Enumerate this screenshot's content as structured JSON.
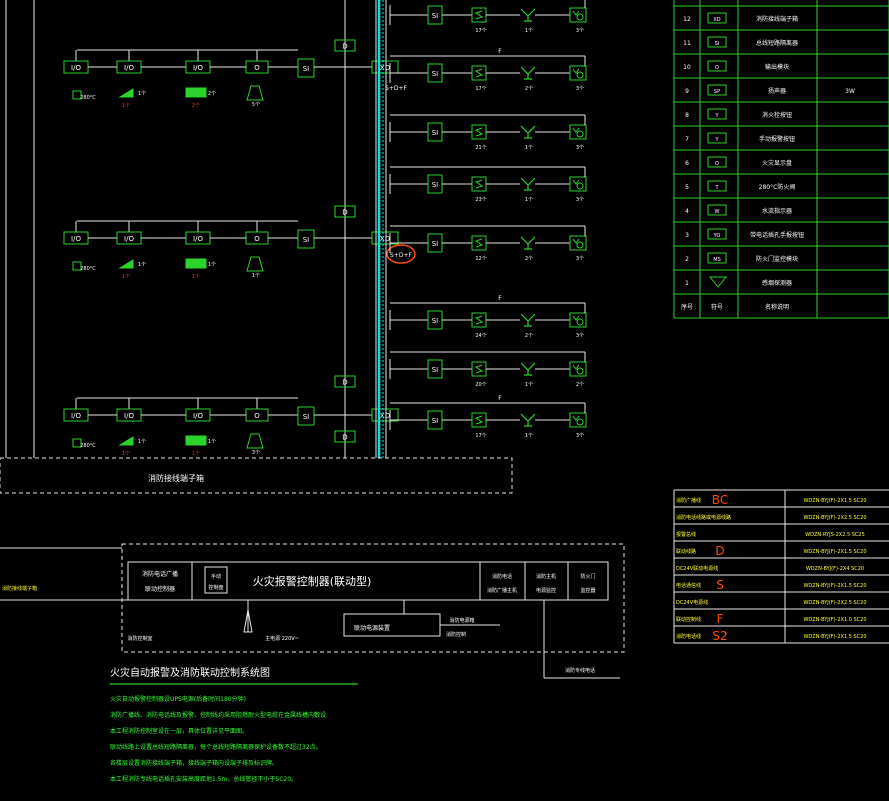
{
  "colors": {
    "background": "#000000",
    "line": "#e6e6e6",
    "device": "#2ad42a",
    "text": "#ffffff",
    "green_text": "#33ff33",
    "red_text": "#ff3030",
    "cyan": "#00e6e6",
    "annotation": "#ff4b00",
    "yellow": "#ffff33"
  },
  "floor_modules": {
    "rows": [
      {
        "io1": "I/O",
        "io2": "I/O",
        "io3": "I/O",
        "o": "O",
        "si": "SI",
        "xd": "XD",
        "temp_label": "280°C",
        "count_1": "1个",
        "count_2": "2个",
        "count_3": "5个"
      },
      {
        "io1": "I/O",
        "io2": "I/O",
        "io3": "I/O",
        "o": "O",
        "si": "SI",
        "xd": "XD",
        "temp_label": "280°C",
        "count_1": "1个",
        "count_2": "1个",
        "count_3": "1个"
      },
      {
        "io1": "I/O",
        "io2": "I/O",
        "io3": "I/O",
        "o": "O",
        "si": "SI",
        "xd": "XD",
        "temp_label": "280°C",
        "count_1": "1个",
        "count_2": "1个",
        "count_3": "3个"
      }
    ],
    "d_box": "D",
    "bus_label": "S+D+F",
    "bus_label_circled": "S+D+F"
  },
  "branches": {
    "si": "SI",
    "f_label": "F",
    "counts_a": [
      "17个",
      "1个",
      "3个"
    ],
    "counts_b": [
      "17个",
      "2个",
      "3个"
    ],
    "counts_c": [
      "21个",
      "1个",
      "3个"
    ],
    "counts_d": [
      "23个",
      "1个",
      "3个"
    ],
    "counts_e": [
      "12个",
      "2个",
      "3个"
    ],
    "counts_f": [
      "24个",
      "2个",
      "3个"
    ],
    "counts_g": [
      "20个",
      "1个",
      "2个"
    ]
  },
  "terminal_box": {
    "label": "消防接线端子箱"
  },
  "controller": {
    "main_label": "火灾报警控制器(联动型)",
    "left_label_1": "消防电话广播",
    "left_label_2": "联动控制器",
    "small_box_1": "手动",
    "small_box_2": "控制盘",
    "right_1_a": "消防电话",
    "right_1_b": "消防广播主机",
    "right_2_a": "消防主机",
    "right_2_b": "电源监控",
    "right_3_a": "防火门",
    "right_3_b": "监控器",
    "sub_box": "联动电源装置",
    "power_label": "主电源 220V~",
    "fire_power_label": "消防电源箱",
    "fire_power_label_2": "消防控制",
    "monitor_label": "消防专线电话",
    "bottom_left": "消防控制室"
  },
  "notes": {
    "title": "火灾自动报警及消防联动控制系统图",
    "lines": [
      "火灾自动报警控制器设UPS电源(后备时间180分钟)",
      "消防广播线、消防电话线及报警、控制线均采用阻燃耐火型电缆在金属线槽内敷设",
      "本工程消防控制室设在一层，具体位置详见平面图。",
      "联动线路上设置总线短路隔离器，每个总线短路隔离器保护设备数不超过32点。",
      "各楼层设置消防接线端子箱，接线端子箱内设端子排及标识牌。",
      "本工程消防专线电话插孔安装高度距地1.5m，总线管径不小于SC20。"
    ]
  },
  "legend": {
    "rows": [
      {
        "num": "12",
        "symbol": "XD",
        "name": "消防接线端子箱",
        "extra": ""
      },
      {
        "num": "11",
        "symbol": "SI",
        "name": "总线短路隔离器",
        "extra": ""
      },
      {
        "num": "10",
        "symbol": "O",
        "name": "输出模块",
        "extra": ""
      },
      {
        "num": "9",
        "symbol": "SP",
        "name": "扬声器",
        "extra": "3W"
      },
      {
        "num": "8",
        "symbol": "Y",
        "name": "消火栓按钮",
        "extra": ""
      },
      {
        "num": "7",
        "symbol": "Y",
        "name": "手动报警按钮",
        "extra": ""
      },
      {
        "num": "6",
        "symbol": "O",
        "name": "火灾显示盘",
        "extra": ""
      },
      {
        "num": "5",
        "symbol": "T",
        "name": "280°C防火阀",
        "extra": ""
      },
      {
        "num": "4",
        "symbol": "W",
        "name": "水流指示器",
        "extra": ""
      },
      {
        "num": "3",
        "symbol": "YO",
        "name": "带电话插孔手报按钮",
        "extra": ""
      },
      {
        "num": "2",
        "symbol": "MS",
        "name": "防火门监控模块",
        "extra": ""
      },
      {
        "num": "1",
        "symbol": "",
        "name": "感烟探测器",
        "extra": ""
      }
    ],
    "header": {
      "num": "序号",
      "symbol": "符号",
      "name": "名称说明"
    }
  },
  "cable_table": {
    "rows": [
      {
        "name": "消防广播线",
        "spec": "WDZN-BYJ(F)-2X1.5  SC20",
        "mark": "BC"
      },
      {
        "name": "消防电话线路或电源线路",
        "spec": "WDZN-BYJ(F)-2X2.5  SC20",
        "mark": ""
      },
      {
        "name": "报警总线",
        "spec": "WDZN-RYJS-2X2.5  SC25",
        "mark": ""
      },
      {
        "name": "联动线路",
        "spec": "WDZN-BYJ(F)-2X1.5  SC20",
        "mark": "D"
      },
      {
        "name": "DC24V联动电源线",
        "spec": "WDZN-BYJ(F)-2X4  SC20",
        "mark": ""
      },
      {
        "name": "电话通信线",
        "spec": "WDZN-BYJ(F)-2X1.5  SC20",
        "mark": "S"
      },
      {
        "name": "DC24V电源线",
        "spec": "WDZN-BYJ(F)-2X2.5  SC20",
        "mark": ""
      },
      {
        "name": "联动控制线",
        "spec": "WDZN-BYJ(F)-2X1.0  SC20",
        "mark": "F"
      },
      {
        "name": "消防电话线",
        "spec": "WDZN-BYJ(F)-2X1.5  SC20",
        "mark": "S2"
      }
    ]
  }
}
